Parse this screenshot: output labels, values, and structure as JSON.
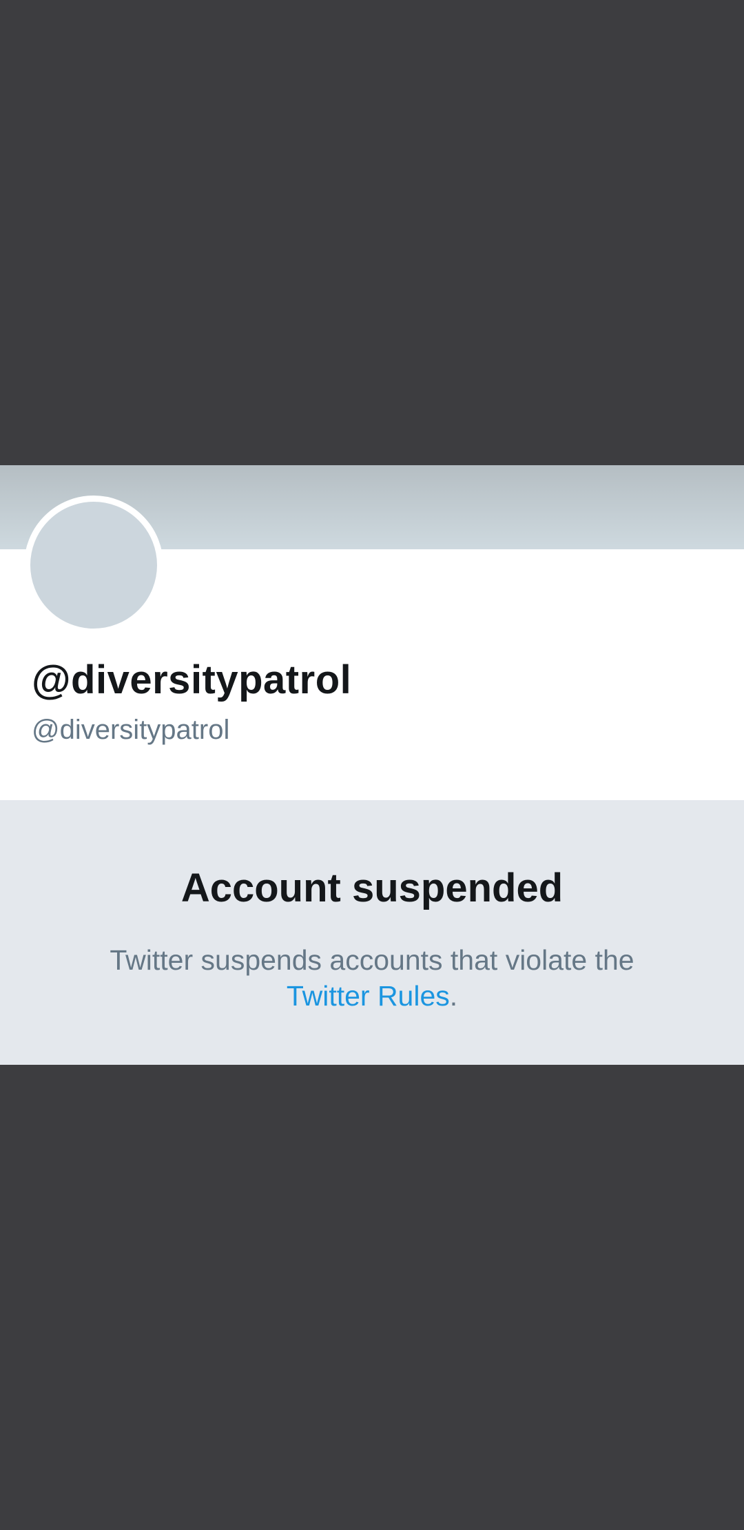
{
  "profile": {
    "display_name": "@diversitypatrol",
    "handle": "@diversitypatrol"
  },
  "suspension": {
    "title": "Account suspended",
    "message_line1": "Twitter suspends accounts that violate the",
    "rules_link": "Twitter Rules",
    "period": "."
  },
  "colors": {
    "backdrop": "#3d3d40",
    "banner": "#ced9df",
    "avatar": "#ccd6dd",
    "panel": "#e4e8ed",
    "link": "#1b95e0",
    "text_primary": "#14171a",
    "text_secondary": "#657786"
  }
}
